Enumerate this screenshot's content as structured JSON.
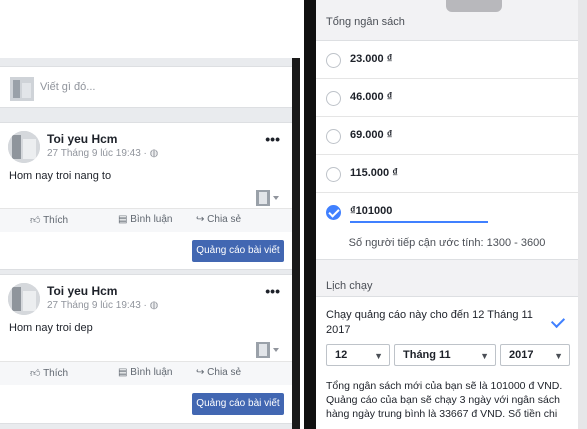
{
  "feed": {
    "composer_placeholder": "Viết gì đó...",
    "posts": [
      {
        "author": "Toi yeu Hcm",
        "meta": "27 Tháng 9 lúc 19:43 · ",
        "text": "Hom nay troi nang to",
        "like_label": "Thích",
        "comment_label": "Bình luận",
        "share_label": "Chia sẻ",
        "boost_label": "Quảng cáo bài viết"
      },
      {
        "author": "Toi yeu Hcm",
        "meta": "27 Tháng 9 lúc 19:43 · ",
        "text": "Hom nay troi dep",
        "like_label": "Thích",
        "comment_label": "Bình luận",
        "share_label": "Chia sẻ",
        "boost_label": "Quảng cáo bài viết"
      }
    ],
    "more_glyph": "•••"
  },
  "budget": {
    "title": "Tổng ngân sách",
    "options": [
      {
        "amount": "23.000 ₫",
        "selected": false
      },
      {
        "amount": "46.000 ₫",
        "selected": false
      },
      {
        "amount": "69.000 ₫",
        "selected": false
      },
      {
        "amount": "115.000 ₫",
        "selected": false
      },
      {
        "amount": "₫101000",
        "selected": true
      }
    ],
    "reach": "Số người tiếp cận ước tính: 1300 - 3600"
  },
  "schedule": {
    "title": "Lịch chạy",
    "run_until": "Chạy quảng cáo này cho đến 12 Tháng 11 2017",
    "day": "12",
    "month": "Tháng 11",
    "year": "2017",
    "arrow": "▼",
    "note": "Tổng ngân sách mới của bạn sẽ là 101000 đ VND. Quảng cáo của bạn sẽ chạy 3 ngày với ngân sách hàng ngày trung bình là 33667 đ VND. Số tiền chi"
  },
  "colors": {
    "fb_blue": "#4267b2",
    "accent_blue": "#4080ff",
    "feed_bg": "#e9ebee"
  }
}
